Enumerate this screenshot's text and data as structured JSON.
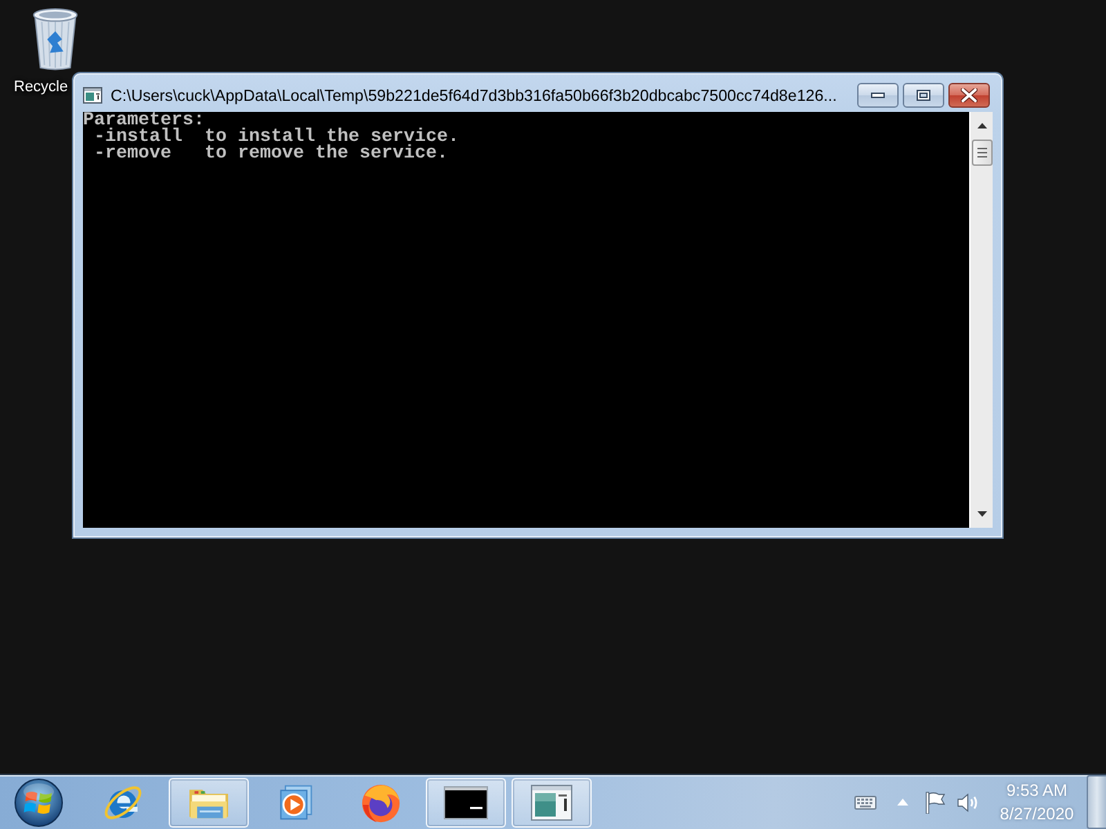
{
  "desktop": {
    "icons": [
      {
        "label": "Recycle"
      }
    ]
  },
  "window": {
    "title": "C:\\Users\\cuck\\AppData\\Local\\Temp\\59b221de5f64d7d3bb316fa50b66f3b20dbcabc7500cc74d8e126...",
    "console_lines": [
      "Parameters:",
      " -install  to install the service.",
      " -remove   to remove the service."
    ]
  },
  "taskbar": {
    "items": [
      {
        "kind": "ie",
        "running": false
      },
      {
        "kind": "explorer",
        "running": true
      },
      {
        "kind": "mediaplayer",
        "running": false
      },
      {
        "kind": "firefox",
        "running": false
      },
      {
        "kind": "console",
        "running": true
      },
      {
        "kind": "window",
        "running": true
      }
    ]
  },
  "tray": {
    "time": "9:53 AM",
    "date": "8/27/2020"
  }
}
